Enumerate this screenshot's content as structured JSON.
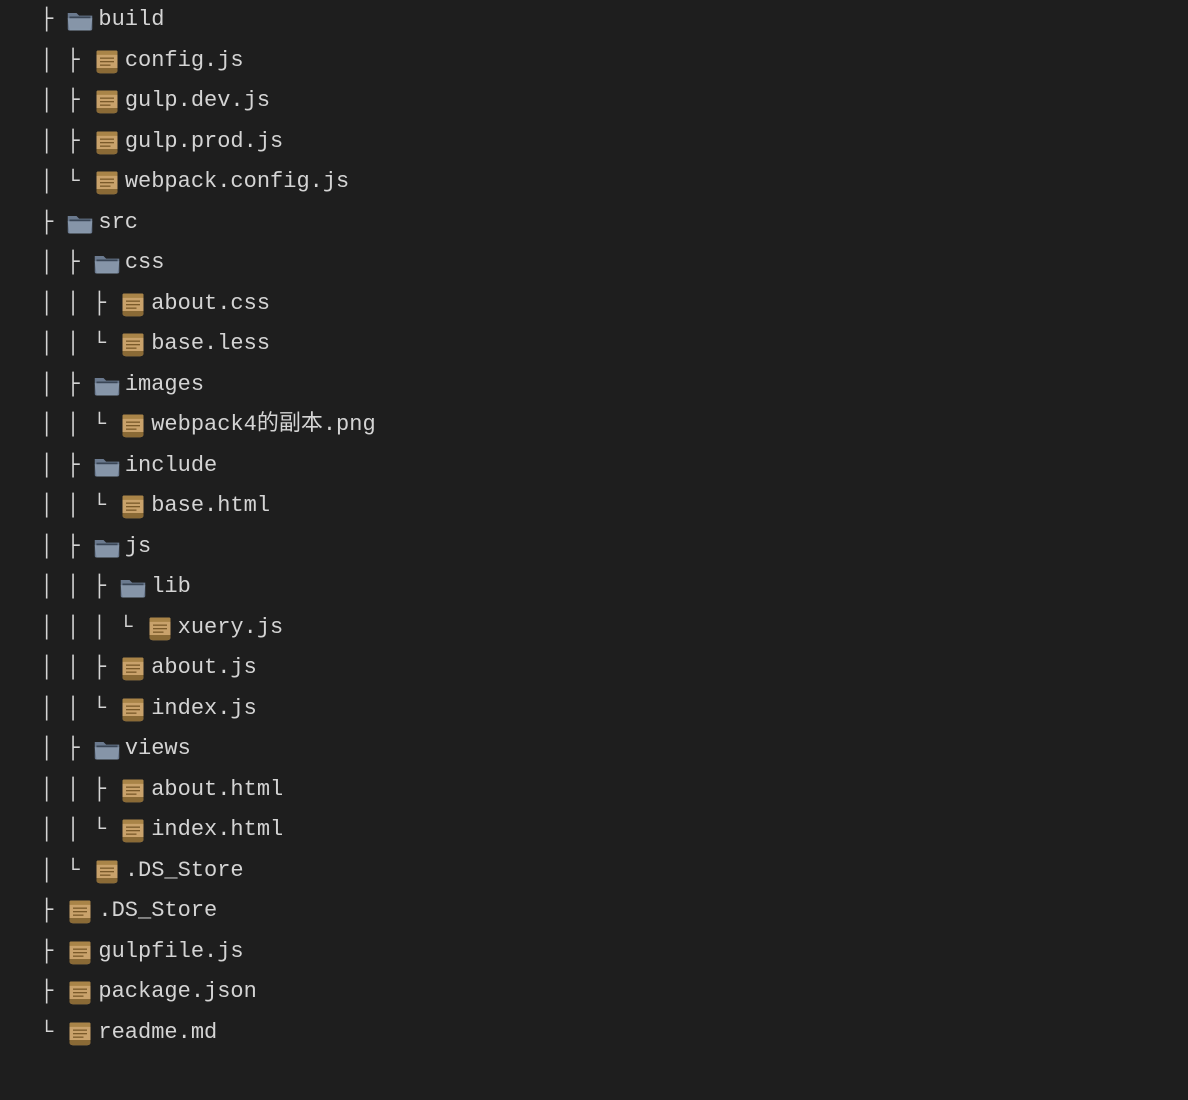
{
  "tree": [
    {
      "prefix": "├ ",
      "type": "folder",
      "name": "build"
    },
    {
      "prefix": "│ ├ ",
      "type": "file",
      "name": "config.js"
    },
    {
      "prefix": "│ ├ ",
      "type": "file",
      "name": "gulp.dev.js"
    },
    {
      "prefix": "│ ├ ",
      "type": "file",
      "name": "gulp.prod.js"
    },
    {
      "prefix": "│ └ ",
      "type": "file",
      "name": "webpack.config.js"
    },
    {
      "prefix": "├ ",
      "type": "folder",
      "name": "src"
    },
    {
      "prefix": "│ ├ ",
      "type": "folder",
      "name": "css"
    },
    {
      "prefix": "│ │ ├ ",
      "type": "file",
      "name": "about.css"
    },
    {
      "prefix": "│ │ └ ",
      "type": "file",
      "name": "base.less"
    },
    {
      "prefix": "│ ├ ",
      "type": "folder",
      "name": "images"
    },
    {
      "prefix": "│ │ └ ",
      "type": "file",
      "name": "webpack4的副本.png"
    },
    {
      "prefix": "│ ├ ",
      "type": "folder",
      "name": "include"
    },
    {
      "prefix": "│ │ └ ",
      "type": "file",
      "name": "base.html"
    },
    {
      "prefix": "│ ├ ",
      "type": "folder",
      "name": "js"
    },
    {
      "prefix": "│ │ ├ ",
      "type": "folder",
      "name": "lib"
    },
    {
      "prefix": "│ │ │ └ ",
      "type": "file",
      "name": "xuery.js"
    },
    {
      "prefix": "│ │ ├ ",
      "type": "file",
      "name": "about.js"
    },
    {
      "prefix": "│ │ └ ",
      "type": "file",
      "name": "index.js"
    },
    {
      "prefix": "│ ├ ",
      "type": "folder",
      "name": "views"
    },
    {
      "prefix": "│ │ ├ ",
      "type": "file",
      "name": "about.html"
    },
    {
      "prefix": "│ │ └ ",
      "type": "file",
      "name": "index.html"
    },
    {
      "prefix": "│ └ ",
      "type": "file",
      "name": ".DS_Store"
    },
    {
      "prefix": "├ ",
      "type": "file",
      "name": ".DS_Store"
    },
    {
      "prefix": "├ ",
      "type": "file",
      "name": "gulpfile.js"
    },
    {
      "prefix": "├ ",
      "type": "file",
      "name": "package.json"
    },
    {
      "prefix": "└ ",
      "type": "file",
      "name": "readme.md"
    }
  ]
}
